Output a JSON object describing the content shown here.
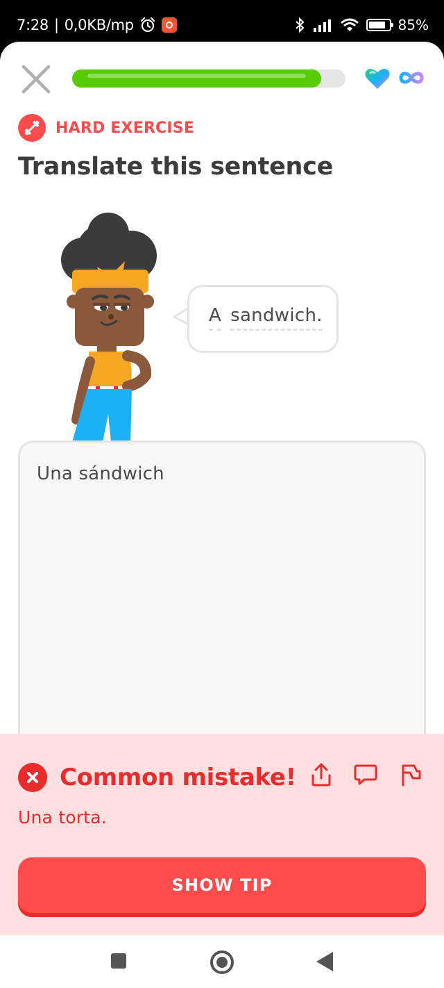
{
  "status_bar": {
    "time": "7:28",
    "network": "0,0KB/mp",
    "battery": "85%"
  },
  "header": {
    "progress": 0.91,
    "hearts": "infinite"
  },
  "exercise": {
    "difficulty_label": "HARD EXERCISE",
    "instruction": "Translate this sentence",
    "prompt_words": [
      "A",
      "sandwich."
    ],
    "user_answer": "Una sándwich"
  },
  "feedback": {
    "title": "Common mistake!",
    "correct_answer": "Una torta.",
    "button_label": "SHOW TIP"
  },
  "colors": {
    "progress_green": "#58cc02",
    "error_red": "#ea2b2b",
    "feedback_bg": "#ffdfe0",
    "button_red": "#ff4b4b"
  },
  "icons": [
    "close-icon",
    "heart-icon",
    "infinity-icon",
    "dumbbell-icon",
    "error-x-icon",
    "share-icon",
    "comment-icon",
    "flag-icon"
  ]
}
